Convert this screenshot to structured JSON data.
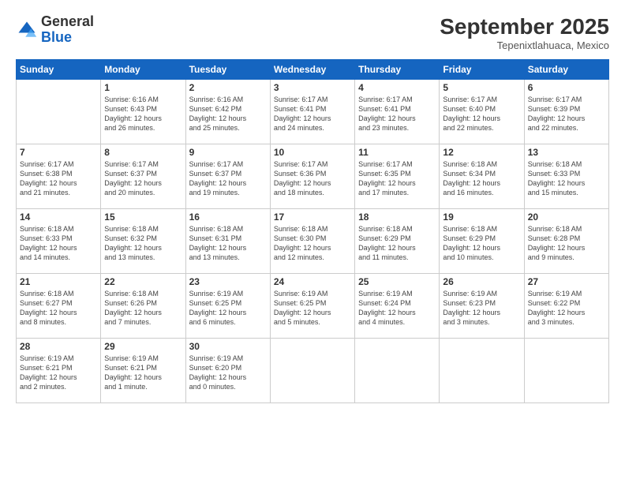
{
  "logo": {
    "general": "General",
    "blue": "Blue"
  },
  "header": {
    "month": "September 2025",
    "location": "Tepenixtlahuaca, Mexico"
  },
  "weekdays": [
    "Sunday",
    "Monday",
    "Tuesday",
    "Wednesday",
    "Thursday",
    "Friday",
    "Saturday"
  ],
  "weeks": [
    [
      {
        "day": "",
        "info": ""
      },
      {
        "day": "1",
        "info": "Sunrise: 6:16 AM\nSunset: 6:43 PM\nDaylight: 12 hours\nand 26 minutes."
      },
      {
        "day": "2",
        "info": "Sunrise: 6:16 AM\nSunset: 6:42 PM\nDaylight: 12 hours\nand 25 minutes."
      },
      {
        "day": "3",
        "info": "Sunrise: 6:17 AM\nSunset: 6:41 PM\nDaylight: 12 hours\nand 24 minutes."
      },
      {
        "day": "4",
        "info": "Sunrise: 6:17 AM\nSunset: 6:41 PM\nDaylight: 12 hours\nand 23 minutes."
      },
      {
        "day": "5",
        "info": "Sunrise: 6:17 AM\nSunset: 6:40 PM\nDaylight: 12 hours\nand 22 minutes."
      },
      {
        "day": "6",
        "info": "Sunrise: 6:17 AM\nSunset: 6:39 PM\nDaylight: 12 hours\nand 22 minutes."
      }
    ],
    [
      {
        "day": "7",
        "info": "Sunrise: 6:17 AM\nSunset: 6:38 PM\nDaylight: 12 hours\nand 21 minutes."
      },
      {
        "day": "8",
        "info": "Sunrise: 6:17 AM\nSunset: 6:37 PM\nDaylight: 12 hours\nand 20 minutes."
      },
      {
        "day": "9",
        "info": "Sunrise: 6:17 AM\nSunset: 6:37 PM\nDaylight: 12 hours\nand 19 minutes."
      },
      {
        "day": "10",
        "info": "Sunrise: 6:17 AM\nSunset: 6:36 PM\nDaylight: 12 hours\nand 18 minutes."
      },
      {
        "day": "11",
        "info": "Sunrise: 6:17 AM\nSunset: 6:35 PM\nDaylight: 12 hours\nand 17 minutes."
      },
      {
        "day": "12",
        "info": "Sunrise: 6:18 AM\nSunset: 6:34 PM\nDaylight: 12 hours\nand 16 minutes."
      },
      {
        "day": "13",
        "info": "Sunrise: 6:18 AM\nSunset: 6:33 PM\nDaylight: 12 hours\nand 15 minutes."
      }
    ],
    [
      {
        "day": "14",
        "info": "Sunrise: 6:18 AM\nSunset: 6:33 PM\nDaylight: 12 hours\nand 14 minutes."
      },
      {
        "day": "15",
        "info": "Sunrise: 6:18 AM\nSunset: 6:32 PM\nDaylight: 12 hours\nand 13 minutes."
      },
      {
        "day": "16",
        "info": "Sunrise: 6:18 AM\nSunset: 6:31 PM\nDaylight: 12 hours\nand 13 minutes."
      },
      {
        "day": "17",
        "info": "Sunrise: 6:18 AM\nSunset: 6:30 PM\nDaylight: 12 hours\nand 12 minutes."
      },
      {
        "day": "18",
        "info": "Sunrise: 6:18 AM\nSunset: 6:29 PM\nDaylight: 12 hours\nand 11 minutes."
      },
      {
        "day": "19",
        "info": "Sunrise: 6:18 AM\nSunset: 6:29 PM\nDaylight: 12 hours\nand 10 minutes."
      },
      {
        "day": "20",
        "info": "Sunrise: 6:18 AM\nSunset: 6:28 PM\nDaylight: 12 hours\nand 9 minutes."
      }
    ],
    [
      {
        "day": "21",
        "info": "Sunrise: 6:18 AM\nSunset: 6:27 PM\nDaylight: 12 hours\nand 8 minutes."
      },
      {
        "day": "22",
        "info": "Sunrise: 6:18 AM\nSunset: 6:26 PM\nDaylight: 12 hours\nand 7 minutes."
      },
      {
        "day": "23",
        "info": "Sunrise: 6:19 AM\nSunset: 6:25 PM\nDaylight: 12 hours\nand 6 minutes."
      },
      {
        "day": "24",
        "info": "Sunrise: 6:19 AM\nSunset: 6:25 PM\nDaylight: 12 hours\nand 5 minutes."
      },
      {
        "day": "25",
        "info": "Sunrise: 6:19 AM\nSunset: 6:24 PM\nDaylight: 12 hours\nand 4 minutes."
      },
      {
        "day": "26",
        "info": "Sunrise: 6:19 AM\nSunset: 6:23 PM\nDaylight: 12 hours\nand 3 minutes."
      },
      {
        "day": "27",
        "info": "Sunrise: 6:19 AM\nSunset: 6:22 PM\nDaylight: 12 hours\nand 3 minutes."
      }
    ],
    [
      {
        "day": "28",
        "info": "Sunrise: 6:19 AM\nSunset: 6:21 PM\nDaylight: 12 hours\nand 2 minutes."
      },
      {
        "day": "29",
        "info": "Sunrise: 6:19 AM\nSunset: 6:21 PM\nDaylight: 12 hours\nand 1 minute."
      },
      {
        "day": "30",
        "info": "Sunrise: 6:19 AM\nSunset: 6:20 PM\nDaylight: 12 hours\nand 0 minutes."
      },
      {
        "day": "",
        "info": ""
      },
      {
        "day": "",
        "info": ""
      },
      {
        "day": "",
        "info": ""
      },
      {
        "day": "",
        "info": ""
      }
    ]
  ]
}
